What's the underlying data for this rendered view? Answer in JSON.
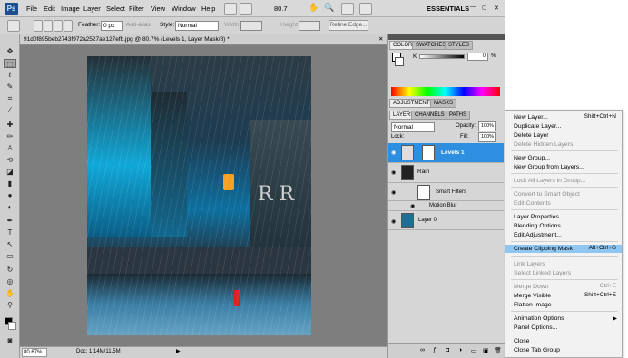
{
  "app": {
    "logo": "Ps",
    "zoom": "80.7",
    "workspace": "ESSENTIALS"
  },
  "menus": [
    "File",
    "Edit",
    "Image",
    "Layer",
    "Select",
    "Filter",
    "View",
    "Window",
    "Help"
  ],
  "options": {
    "feather_label": "Feather:",
    "feather_value": "0 px",
    "antialias": "Anti-alias",
    "style_label": "Style:",
    "style_value": "Normal",
    "width_label": "Width:",
    "height_label": "Height:",
    "refine_edge": "Refine Edge..."
  },
  "document": {
    "tab_title": "91d0f895beb2743f972a2527ae127efb.jpg @ 80.7% (Levels 1, Layer Mask/8) *",
    "status_zoom": "80.67%",
    "status_doc": "Doc: 1.14M/11.5M"
  },
  "color_panel": {
    "tabs": [
      "COLOR",
      "SWATCHES",
      "STYLES"
    ],
    "k_label": "K",
    "k_value": "0",
    "k_unit": "%"
  },
  "adjust_panel": {
    "tabs": [
      "ADJUSTMENTS",
      "MASKS"
    ]
  },
  "layers_panel": {
    "tabs": [
      "LAYERS",
      "CHANNELS",
      "PATHS"
    ],
    "blend_mode": "Normal",
    "opacity_label": "Opacity:",
    "opacity_value": "100%",
    "lock_label": "Lock:",
    "fill_label": "Fill:",
    "fill_value": "100%",
    "layers": [
      {
        "name": "Levels 1"
      },
      {
        "name": "Rain"
      },
      {
        "name": "Smart Filters"
      },
      {
        "name": "Motion Blur"
      },
      {
        "name": "Layer 0"
      }
    ]
  },
  "context_menu": {
    "items": [
      {
        "label": "New Layer...",
        "shortcut": "Shift+Ctrl+N"
      },
      {
        "label": "Duplicate Layer..."
      },
      {
        "label": "Delete Layer"
      },
      {
        "label": "Delete Hidden Layers"
      },
      {
        "label": "New Group..."
      },
      {
        "label": "New Group from Layers..."
      },
      {
        "label": "Lock All Layers in Group..."
      },
      {
        "label": "Convert to Smart Object"
      },
      {
        "label": "Edit Contents"
      },
      {
        "label": "Layer Properties..."
      },
      {
        "label": "Blending Options..."
      },
      {
        "label": "Edit Adjustment..."
      },
      {
        "label": "Create Clipping Mask",
        "shortcut": "Alt+Ctrl+G"
      },
      {
        "label": "Link Layers"
      },
      {
        "label": "Select Linked Layers"
      },
      {
        "label": "Merge Down",
        "shortcut": "Ctrl+E"
      },
      {
        "label": "Merge Visible",
        "shortcut": "Shift+Ctrl+E"
      },
      {
        "label": "Flatten Image"
      },
      {
        "label": "Animation Options"
      },
      {
        "label": "Panel Options..."
      },
      {
        "label": "Close"
      },
      {
        "label": "Close Tab Group"
      }
    ]
  }
}
